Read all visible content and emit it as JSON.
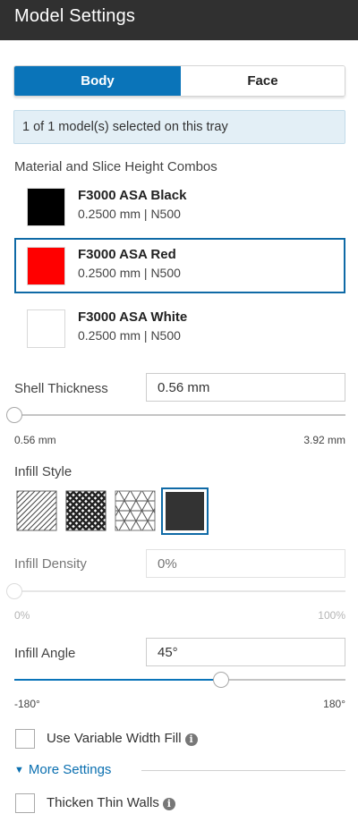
{
  "header": {
    "title": "Model Settings"
  },
  "tabs": [
    {
      "label": "Body",
      "active": true
    },
    {
      "label": "Face",
      "active": false
    }
  ],
  "selection_info": "1 of 1 model(s) selected on this tray",
  "materials": {
    "section_label": "Material and Slice Height Combos",
    "items": [
      {
        "name": "F3000 ASA Black",
        "detail": "0.2500 mm | N500",
        "color": "#000000",
        "selected": false
      },
      {
        "name": "F3000 ASA Red",
        "detail": "0.2500 mm | N500",
        "color": "#ff0000",
        "selected": true
      },
      {
        "name": "F3000 ASA White",
        "detail": "0.2500 mm | N500",
        "color": "#ffffff",
        "selected": false
      }
    ]
  },
  "shell_thickness": {
    "label": "Shell Thickness",
    "value": "0.56 mm",
    "min_label": "0.56 mm",
    "max_label": "3.92 mm",
    "slider_fraction": 0.0
  },
  "infill_style": {
    "label": "Infill Style",
    "options": [
      {
        "icon": "diagonal-hatch-icon",
        "selected": false
      },
      {
        "icon": "crosshatch-icon",
        "selected": false
      },
      {
        "icon": "triangular-grid-icon",
        "selected": false
      },
      {
        "icon": "solid-fill-icon",
        "selected": true
      }
    ]
  },
  "infill_density": {
    "label": "Infill Density",
    "placeholder": "0%",
    "min_label": "0%",
    "max_label": "100%",
    "slider_fraction": 0.0,
    "disabled": true
  },
  "infill_angle": {
    "label": "Infill Angle",
    "value": "45°",
    "min_label": "-180°",
    "max_label": "180°",
    "slider_fraction": 0.625
  },
  "variable_width_fill": {
    "label": "Use Variable Width Fill",
    "checked": false
  },
  "more_settings": {
    "label": "More Settings",
    "expanded": true
  },
  "thicken_thin_walls": {
    "label": "Thicken Thin Walls",
    "checked": false
  },
  "colors": {
    "accent": "#0a74b9",
    "header_bg": "#303030",
    "info_bg": "#e3eff6"
  }
}
